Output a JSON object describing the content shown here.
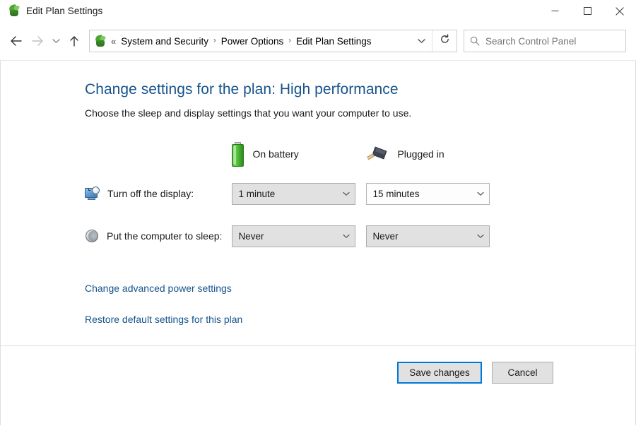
{
  "window": {
    "title": "Edit Plan Settings",
    "app_icon": "power-plan-icon",
    "controls": {
      "minimize": "minimize-icon",
      "maximize": "maximize-icon",
      "close": "close-icon"
    }
  },
  "navigation": {
    "back": "back-arrow-icon",
    "forward": "forward-arrow-icon",
    "recent": "chevron-down-icon",
    "up": "up-arrow-icon",
    "refresh": "refresh-icon",
    "breadcrumb": {
      "icon": "power-plan-icon",
      "overflow": "«",
      "separator": "›",
      "items": [
        "System and Security",
        "Power Options",
        "Edit Plan Settings"
      ],
      "dropdown": "chevron-down-icon"
    }
  },
  "search": {
    "icon": "search-icon",
    "value": "",
    "placeholder": "Search Control Panel"
  },
  "page": {
    "heading": "Change settings for the plan: High performance",
    "subheading": "Choose the sleep and display settings that you want your computer to use."
  },
  "columns": [
    {
      "icon": "battery-icon",
      "label": "On battery"
    },
    {
      "icon": "power-plug-icon",
      "label": "Plugged in"
    }
  ],
  "settings_rows": [
    {
      "icon": "display-clock-icon",
      "label": "Turn off the display:",
      "on_battery": "1 minute",
      "plugged_in": "15 minutes"
    },
    {
      "icon": "sleep-moon-icon",
      "label": "Put the computer to sleep:",
      "on_battery": "Never",
      "plugged_in": "Never"
    }
  ],
  "links": [
    "Change advanced power settings",
    "Restore default settings for this plan"
  ],
  "footer": {
    "save_label": "Save changes",
    "cancel_label": "Cancel"
  },
  "colors": {
    "link": "#16538c",
    "heading": "#16538c",
    "accent_focus": "#0078d7",
    "battery_green": "#49b833",
    "control_face": "#e1e1e1",
    "control_border": "#adadad"
  }
}
